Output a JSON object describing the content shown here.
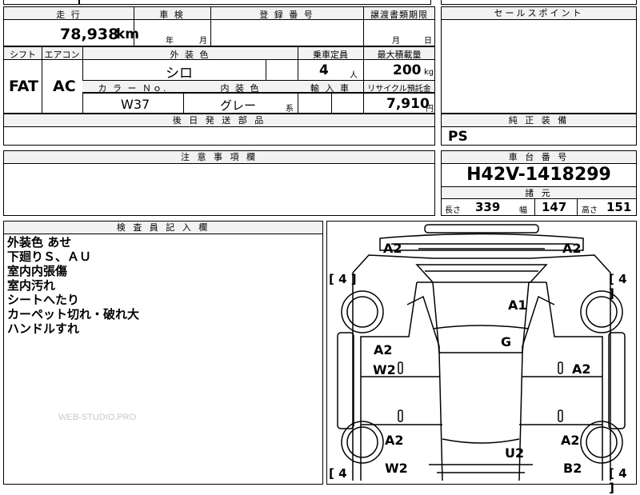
{
  "top": {
    "mileage_label": "走 行",
    "mileage_value": "78,938",
    "mileage_unit": "km",
    "shaken_label": "車 検",
    "shaken_year_unit": "年",
    "shaken_month_unit": "月",
    "registration_label": "登 録 番 号",
    "transfer_docs_label": "譲渡書類期限",
    "transfer_month_unit": "月",
    "transfer_day_unit": "日"
  },
  "spec": {
    "shift_label": "シフト",
    "shift_value": "FAT",
    "aircon_label": "エアコン",
    "aircon_value": "AC",
    "exterior_color_label": "外 装 色",
    "exterior_color_value": "シロ",
    "capacity_label": "乗車定員",
    "capacity_value": "4",
    "capacity_unit": "人",
    "max_load_label": "最大積載量",
    "max_load_value": "200",
    "max_load_unit": "kg",
    "color_no_label": "カ ラ ー Ｎｏ.",
    "color_no_value": "W37",
    "interior_color_label": "内 装 色",
    "interior_color_value": "グレー",
    "interior_color_suffix": "系",
    "import_label": "輸 入 車",
    "recycle_label": "リサイクル預託金",
    "recycle_value": "7,910",
    "recycle_unit": "円"
  },
  "sales_point_label": "セールスポイント",
  "later_parts_label": "後 日 発 送 部 品",
  "genuine_equipment_label": "純 正 装 備",
  "genuine_equipment_value": "PS",
  "caution_label": "注 意 事 項 欄",
  "chassis": {
    "label": "車 台 番 号",
    "value": "H42V-1418299",
    "specs_label": "諸 元",
    "length_label": "長さ",
    "length_value": "339",
    "width_label": "幅",
    "width_value": "147",
    "height_label": "高さ",
    "height_value": "151"
  },
  "inspector": {
    "label": "検 査 員 記 入 欄",
    "notes": [
      "外装色 あせ",
      "下廻りＳ、ＡＵ",
      "室内内張傷",
      "室内汚れ",
      "シートへたり",
      "カーペット切れ・破れ大",
      "ハンドルすれ"
    ]
  },
  "watermark": "WEB-STUDIO.PRO",
  "diagram": {
    "tires": [
      "[ 4 ]",
      "[ 4 ]",
      "[ 4",
      "[ 4 ]"
    ],
    "marks": {
      "front_left": "A2",
      "front_right": "A2",
      "hood": "A1",
      "roof": "G",
      "front_left_door_a": "A2",
      "front_left_door_w": "W2",
      "front_right_door": "A2",
      "rear_left": "A2",
      "rear_left_w": "W2",
      "rear_right": "A2",
      "tailgate": "U2",
      "rear_bumper_right": "B2"
    }
  }
}
